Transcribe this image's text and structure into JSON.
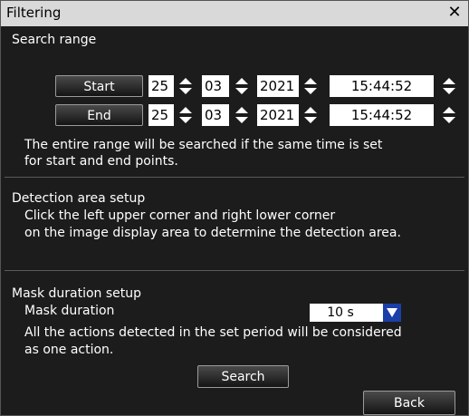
{
  "title": "Filtering",
  "close_icon": "close-icon",
  "search_range": {
    "label": "Search range",
    "start": {
      "button": "Start",
      "day": "25",
      "month": "03",
      "year": "2021",
      "time": "15:44:52"
    },
    "end": {
      "button": "End",
      "day": "25",
      "month": "03",
      "year": "2021",
      "time": "15:44:52"
    },
    "note_line1": "The entire range will be searched if the same time is set",
    "note_line2": "for start and end points."
  },
  "detection": {
    "label": "Detection area setup",
    "line1": "Click the left upper corner and right lower corner",
    "line2": "on the image display area to determine the detection area."
  },
  "mask": {
    "label": "Mask duration setup",
    "field_label": "Mask duration",
    "value": "10 s",
    "line1": "All the actions detected in the set period will be considered",
    "line2": "as one action."
  },
  "buttons": {
    "search": "Search",
    "back": "Back"
  },
  "colors": {
    "accent": "#1a3fa8",
    "titlebar": "#d9d9d9",
    "background": "#1c1c1c"
  }
}
